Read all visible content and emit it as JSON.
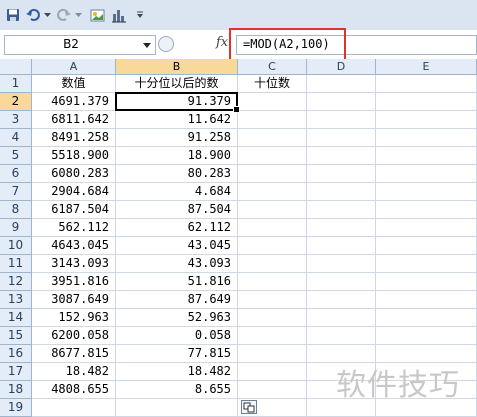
{
  "formula_bar": {
    "name_box": "B2",
    "fx_label": "fx",
    "formula": "=MOD(A2,100)"
  },
  "columns": [
    "A",
    "B",
    "C",
    "D",
    "E"
  ],
  "headers": {
    "a": "数值",
    "b": "十分位以后的数",
    "c": "十位数"
  },
  "rows": [
    {
      "n": "1"
    },
    {
      "n": "2",
      "a": "4691.379",
      "b": "91.379"
    },
    {
      "n": "3",
      "a": "6811.642",
      "b": "11.642"
    },
    {
      "n": "4",
      "a": "8491.258",
      "b": "91.258"
    },
    {
      "n": "5",
      "a": "5518.900",
      "b": "18.900"
    },
    {
      "n": "6",
      "a": "6080.283",
      "b": "80.283"
    },
    {
      "n": "7",
      "a": "2904.684",
      "b": "4.684"
    },
    {
      "n": "8",
      "a": "6187.504",
      "b": "87.504"
    },
    {
      "n": "9",
      "a": "562.112",
      "b": "62.112"
    },
    {
      "n": "10",
      "a": "4643.045",
      "b": "43.045"
    },
    {
      "n": "11",
      "a": "3143.093",
      "b": "43.093"
    },
    {
      "n": "12",
      "a": "3951.816",
      "b": "51.816"
    },
    {
      "n": "13",
      "a": "3087.649",
      "b": "87.649"
    },
    {
      "n": "14",
      "a": "152.963",
      "b": "52.963"
    },
    {
      "n": "15",
      "a": "6200.058",
      "b": "0.058"
    },
    {
      "n": "16",
      "a": "8677.815",
      "b": "77.815"
    },
    {
      "n": "17",
      "a": "18.482",
      "b": "18.482"
    },
    {
      "n": "18",
      "a": "4808.655",
      "b": "8.655"
    },
    {
      "n": "19"
    }
  ],
  "watermark": "软件技巧"
}
